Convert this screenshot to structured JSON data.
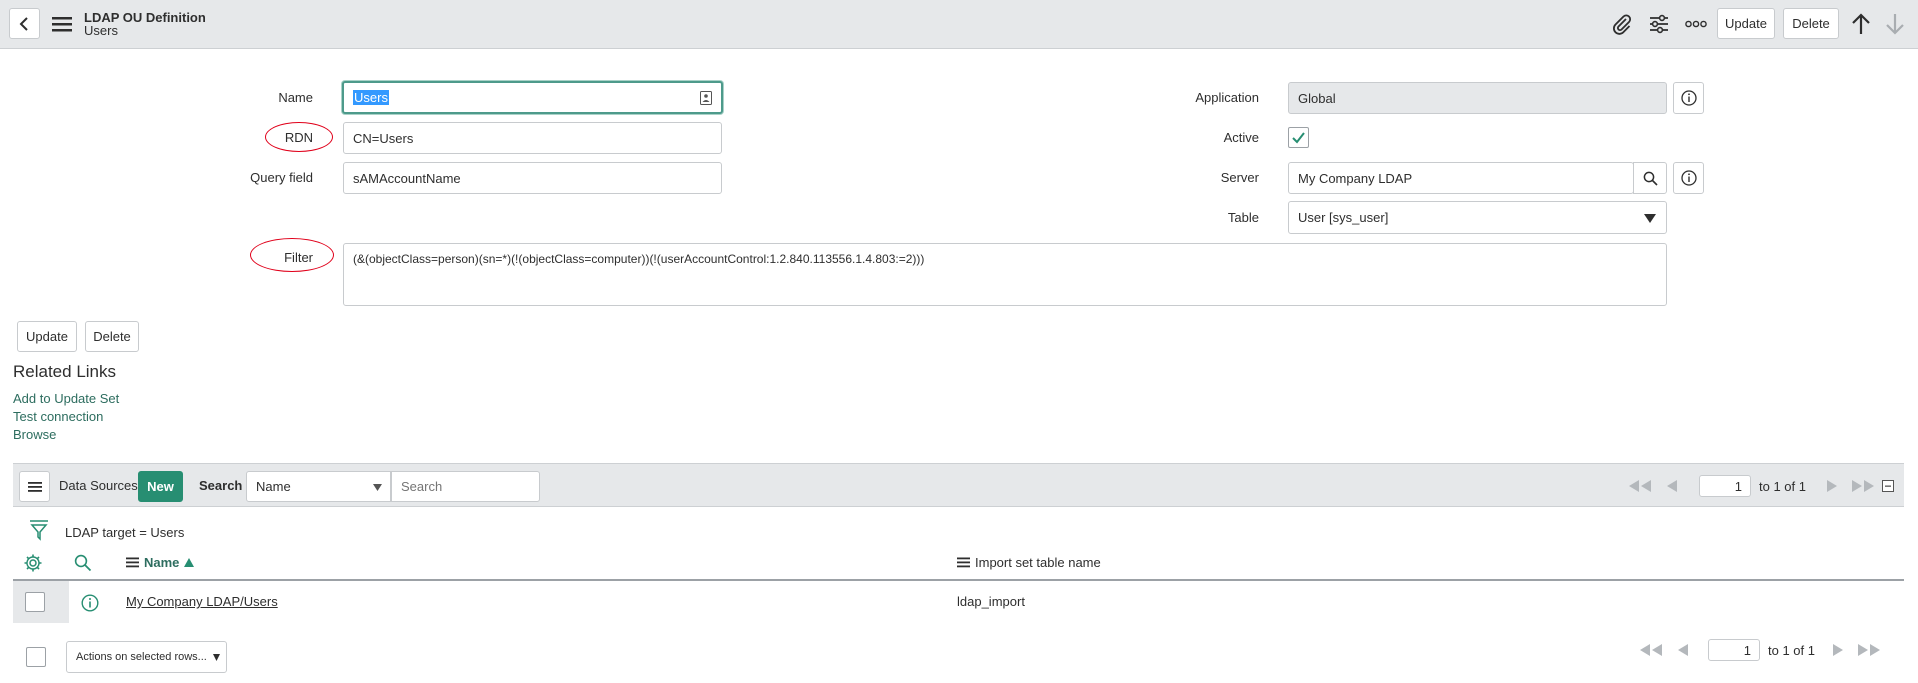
{
  "header": {
    "title": "LDAP OU Definition",
    "subtitle": "Users",
    "update_label": "Update",
    "delete_label": "Delete"
  },
  "form": {
    "name_label": "Name",
    "name_value": "Users",
    "rdn_label": "RDN",
    "rdn_value": "CN=Users",
    "query_field_label": "Query field",
    "query_field_value": "sAMAccountName",
    "filter_label": "Filter",
    "filter_value": "(&(objectClass=person)(sn=*)(!(objectClass=computer))(!(userAccountControl:1.2.840.113556.1.4.803:=2)))",
    "application_label": "Application",
    "application_value": "Global",
    "active_label": "Active",
    "active_checked": true,
    "server_label": "Server",
    "server_value": "My Company LDAP",
    "table_label": "Table",
    "table_value": "User [sys_user]"
  },
  "form_buttons": {
    "update_label": "Update",
    "delete_label": "Delete"
  },
  "related_links": {
    "heading": "Related Links",
    "items": [
      "Add to Update Set",
      "Test connection",
      "Browse"
    ]
  },
  "list": {
    "title": "Data Sources",
    "new_label": "New",
    "search_label": "Search",
    "search_field_value": "Name",
    "search_placeholder": "Search",
    "breadcrumb": "LDAP target = Users",
    "columns": [
      "Name",
      "Import set table name"
    ],
    "rows": [
      {
        "name": "My Company LDAP/Users",
        "import_set_table": "ldap_import"
      }
    ],
    "pager_top": {
      "page": "1",
      "range": "to 1 of 1"
    },
    "pager_bottom": {
      "page": "1",
      "range": "to 1 of 1"
    },
    "actions_label": "Actions on selected rows..."
  },
  "colors": {
    "accent": "#278e72",
    "link": "#2d6d5f",
    "annotation": "#e0001a",
    "focus": "#4d9a8b"
  }
}
